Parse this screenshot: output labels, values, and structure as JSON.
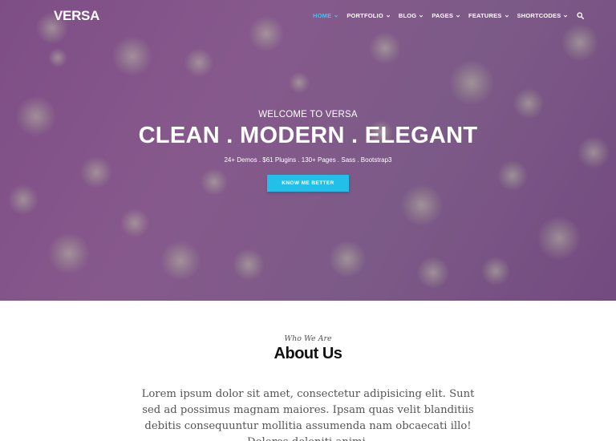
{
  "nav": {
    "logo": "VERSA",
    "items": [
      {
        "label": "HOME",
        "active": true
      },
      {
        "label": "PORTFOLIO"
      },
      {
        "label": "BLOG"
      },
      {
        "label": "PAGES"
      },
      {
        "label": "FEATURES"
      },
      {
        "label": "SHORTCODES"
      }
    ],
    "search_icon": "search-icon"
  },
  "hero": {
    "welcome": "WELCOME TO VERSA",
    "headline": "CLEAN . MODERN . ELEGANT",
    "features_line": "24+ Demos . $61 Plugins . 130+ Pages . Sass . Bootstrap3",
    "cta_label": "KNOW ME BETTER"
  },
  "about": {
    "eyebrow": "Who We Are",
    "title": "About Us",
    "text": "Lorem ipsum dolor sit amet, consectetur adipisicing elit. Sunt sed ad possimus magnam maiores. Ipsam quas velit blanditiis debitis consequuntur mollitia assumenda nam obcaecati illo! Dolores deleniti animi."
  },
  "colors": {
    "accent": "#22bfe8",
    "active_nav": "#3fc3ee",
    "hero_bg": "#80558a"
  }
}
